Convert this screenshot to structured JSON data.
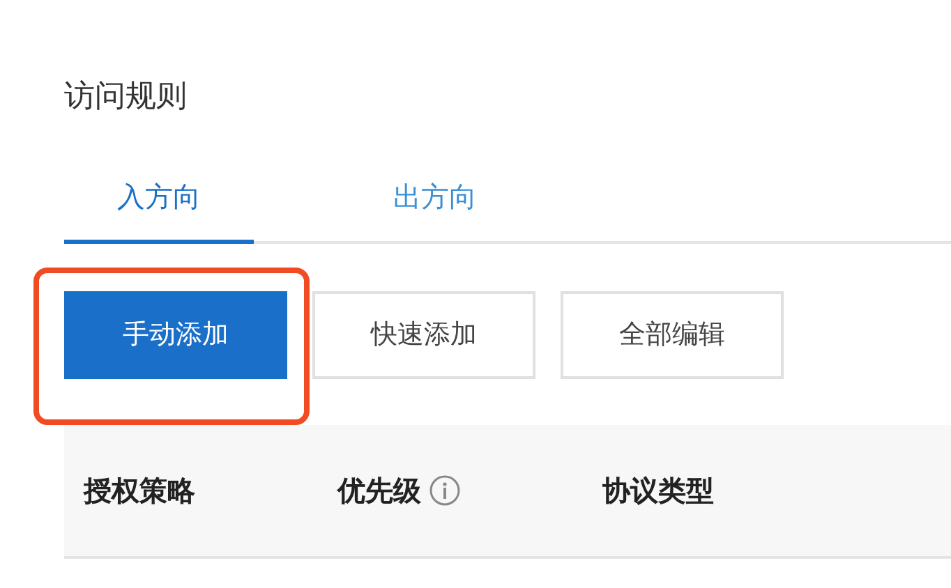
{
  "title": "访问规则",
  "tabs": [
    {
      "label": "入方向",
      "selected": true
    },
    {
      "label": "出方向",
      "selected": false
    }
  ],
  "buttons": [
    {
      "label": "手动添加",
      "kind": "primary",
      "highlighted": true
    },
    {
      "label": "快速添加",
      "kind": "default",
      "highlighted": false
    },
    {
      "label": "全部编辑",
      "kind": "default",
      "highlighted": false
    }
  ],
  "table": {
    "columns": [
      {
        "label": "授权策略",
        "info": false
      },
      {
        "label": "优先级",
        "info": true
      },
      {
        "label": "协议类型",
        "info": false
      }
    ]
  }
}
